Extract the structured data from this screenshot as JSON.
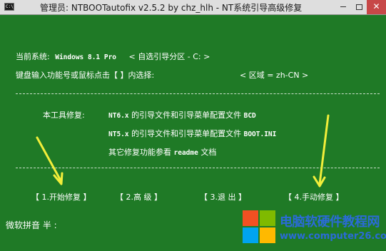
{
  "window": {
    "title": "管理员:  NTBOOTautofix v2.5.2 by chz_hlh - NT系统引导高级修复",
    "icon_text": "C:\\"
  },
  "status": {
    "current_system_label": "当前系统:",
    "current_system_value": "Windows 8.1 Pro",
    "boot_partition": "< 自选引导分区 - C: >",
    "keyboard_prompt": "键盘输入功能号或鼠标点击【 】内选择:",
    "locale": "< 区域 = zh-CN >"
  },
  "description": {
    "label": "本工具修复:",
    "nt6_prefix": "NT6.x",
    "nt6_text": "的引导文件和引导菜单配置文件",
    "nt6_file": "BCD",
    "nt5_prefix": "NT5.x",
    "nt5_text": "的引导文件和引导菜单配置文件",
    "nt5_file": "BOOT.INI",
    "other_text": "其它修复功能参看",
    "other_file": "readme",
    "other_suffix": "文档"
  },
  "menu": {
    "start_repair": "【 1.开始修复 】",
    "advanced": "【  2.高  级  】",
    "exit": "【  3.退  出  】",
    "manual_repair": "【 4.手动修复 】"
  },
  "ime": {
    "text": "微软拼音  半 :"
  },
  "watermark": {
    "site_name": "电脑软硬件教程网",
    "site_url": "www.computer26.com"
  },
  "colors": {
    "console_bg": "#1f7a26",
    "console_text": "#ffffff",
    "arrow": "#f2ee3a",
    "site_text": "#2a6bd8"
  },
  "icons": {
    "app_icon": "console-icon",
    "minimize": "minimize-icon",
    "maximize": "maximize-icon",
    "close": "close-icon"
  }
}
